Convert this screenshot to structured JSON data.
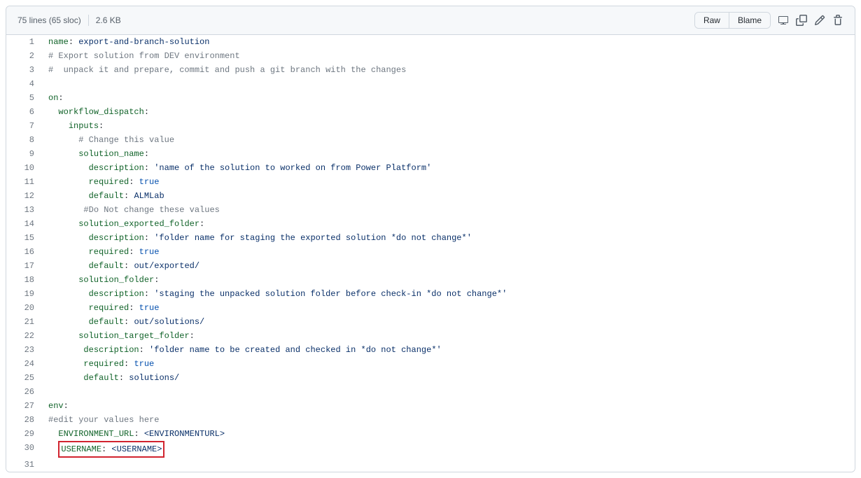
{
  "header": {
    "lines_text": "75 lines (65 sloc)",
    "size_text": "2.6 KB",
    "raw_label": "Raw",
    "blame_label": "Blame"
  },
  "code": {
    "lines": [
      {
        "n": 1,
        "segs": [
          [
            "ent",
            "name"
          ],
          [
            "pln",
            ": "
          ],
          [
            "s",
            "export-and-branch-solution"
          ]
        ]
      },
      {
        "n": 2,
        "segs": [
          [
            "c",
            "# Export solution from DEV environment"
          ]
        ]
      },
      {
        "n": 3,
        "segs": [
          [
            "c",
            "#  unpack it and prepare, commit and push a git branch with the changes"
          ]
        ]
      },
      {
        "n": 4,
        "segs": []
      },
      {
        "n": 5,
        "segs": [
          [
            "ent",
            "on"
          ],
          [
            "pln",
            ":"
          ]
        ]
      },
      {
        "n": 6,
        "segs": [
          [
            "pln",
            "  "
          ],
          [
            "ent",
            "workflow_dispatch"
          ],
          [
            "pln",
            ":"
          ]
        ]
      },
      {
        "n": 7,
        "segs": [
          [
            "pln",
            "    "
          ],
          [
            "ent",
            "inputs"
          ],
          [
            "pln",
            ":"
          ]
        ]
      },
      {
        "n": 8,
        "segs": [
          [
            "pln",
            "      "
          ],
          [
            "c",
            "# Change this value"
          ]
        ]
      },
      {
        "n": 9,
        "segs": [
          [
            "pln",
            "      "
          ],
          [
            "ent",
            "solution_name"
          ],
          [
            "pln",
            ":"
          ]
        ]
      },
      {
        "n": 10,
        "segs": [
          [
            "pln",
            "        "
          ],
          [
            "ent",
            "description"
          ],
          [
            "pln",
            ": "
          ],
          [
            "s",
            "'name of the solution to worked on from Power Platform'"
          ]
        ]
      },
      {
        "n": 11,
        "segs": [
          [
            "pln",
            "        "
          ],
          [
            "ent",
            "required"
          ],
          [
            "pln",
            ": "
          ],
          [
            "c1",
            "true"
          ]
        ]
      },
      {
        "n": 12,
        "segs": [
          [
            "pln",
            "        "
          ],
          [
            "ent",
            "default"
          ],
          [
            "pln",
            ": "
          ],
          [
            "s",
            "ALMLab"
          ]
        ]
      },
      {
        "n": 13,
        "segs": [
          [
            "pln",
            "       "
          ],
          [
            "c",
            "#Do Not change these values"
          ]
        ]
      },
      {
        "n": 14,
        "segs": [
          [
            "pln",
            "      "
          ],
          [
            "ent",
            "solution_exported_folder"
          ],
          [
            "pln",
            ":"
          ]
        ]
      },
      {
        "n": 15,
        "segs": [
          [
            "pln",
            "        "
          ],
          [
            "ent",
            "description"
          ],
          [
            "pln",
            ": "
          ],
          [
            "s",
            "'folder name for staging the exported solution *do not change*'"
          ]
        ]
      },
      {
        "n": 16,
        "segs": [
          [
            "pln",
            "        "
          ],
          [
            "ent",
            "required"
          ],
          [
            "pln",
            ": "
          ],
          [
            "c1",
            "true"
          ]
        ]
      },
      {
        "n": 17,
        "segs": [
          [
            "pln",
            "        "
          ],
          [
            "ent",
            "default"
          ],
          [
            "pln",
            ": "
          ],
          [
            "s",
            "out/exported/"
          ]
        ]
      },
      {
        "n": 18,
        "segs": [
          [
            "pln",
            "      "
          ],
          [
            "ent",
            "solution_folder"
          ],
          [
            "pln",
            ":"
          ]
        ]
      },
      {
        "n": 19,
        "segs": [
          [
            "pln",
            "        "
          ],
          [
            "ent",
            "description"
          ],
          [
            "pln",
            ": "
          ],
          [
            "s",
            "'staging the unpacked solution folder before check-in *do not change*'"
          ]
        ]
      },
      {
        "n": 20,
        "segs": [
          [
            "pln",
            "        "
          ],
          [
            "ent",
            "required"
          ],
          [
            "pln",
            ": "
          ],
          [
            "c1",
            "true"
          ]
        ]
      },
      {
        "n": 21,
        "segs": [
          [
            "pln",
            "        "
          ],
          [
            "ent",
            "default"
          ],
          [
            "pln",
            ": "
          ],
          [
            "s",
            "out/solutions/"
          ]
        ]
      },
      {
        "n": 22,
        "segs": [
          [
            "pln",
            "      "
          ],
          [
            "ent",
            "solution_target_folder"
          ],
          [
            "pln",
            ":"
          ]
        ]
      },
      {
        "n": 23,
        "segs": [
          [
            "pln",
            "       "
          ],
          [
            "ent",
            "description"
          ],
          [
            "pln",
            ": "
          ],
          [
            "s",
            "'folder name to be created and checked in *do not change*'"
          ]
        ]
      },
      {
        "n": 24,
        "segs": [
          [
            "pln",
            "       "
          ],
          [
            "ent",
            "required"
          ],
          [
            "pln",
            ": "
          ],
          [
            "c1",
            "true"
          ]
        ]
      },
      {
        "n": 25,
        "segs": [
          [
            "pln",
            "       "
          ],
          [
            "ent",
            "default"
          ],
          [
            "pln",
            ": "
          ],
          [
            "s",
            "solutions/"
          ]
        ]
      },
      {
        "n": 26,
        "segs": []
      },
      {
        "n": 27,
        "segs": [
          [
            "ent",
            "env"
          ],
          [
            "pln",
            ":"
          ]
        ]
      },
      {
        "n": 28,
        "segs": [
          [
            "c",
            "#edit your values here"
          ]
        ]
      },
      {
        "n": 29,
        "segs": [
          [
            "pln",
            "  "
          ],
          [
            "ent",
            "ENVIRONMENT_URL"
          ],
          [
            "pln",
            ": "
          ],
          [
            "s",
            "<ENVIRONMENTURL>"
          ]
        ]
      },
      {
        "n": 30,
        "highlight": true,
        "segs": [
          [
            "pln",
            "  "
          ],
          [
            "ent",
            "USERNAME"
          ],
          [
            "pln",
            ": "
          ],
          [
            "s",
            "<USERNAME>"
          ]
        ]
      },
      {
        "n": 31,
        "segs": []
      }
    ]
  }
}
